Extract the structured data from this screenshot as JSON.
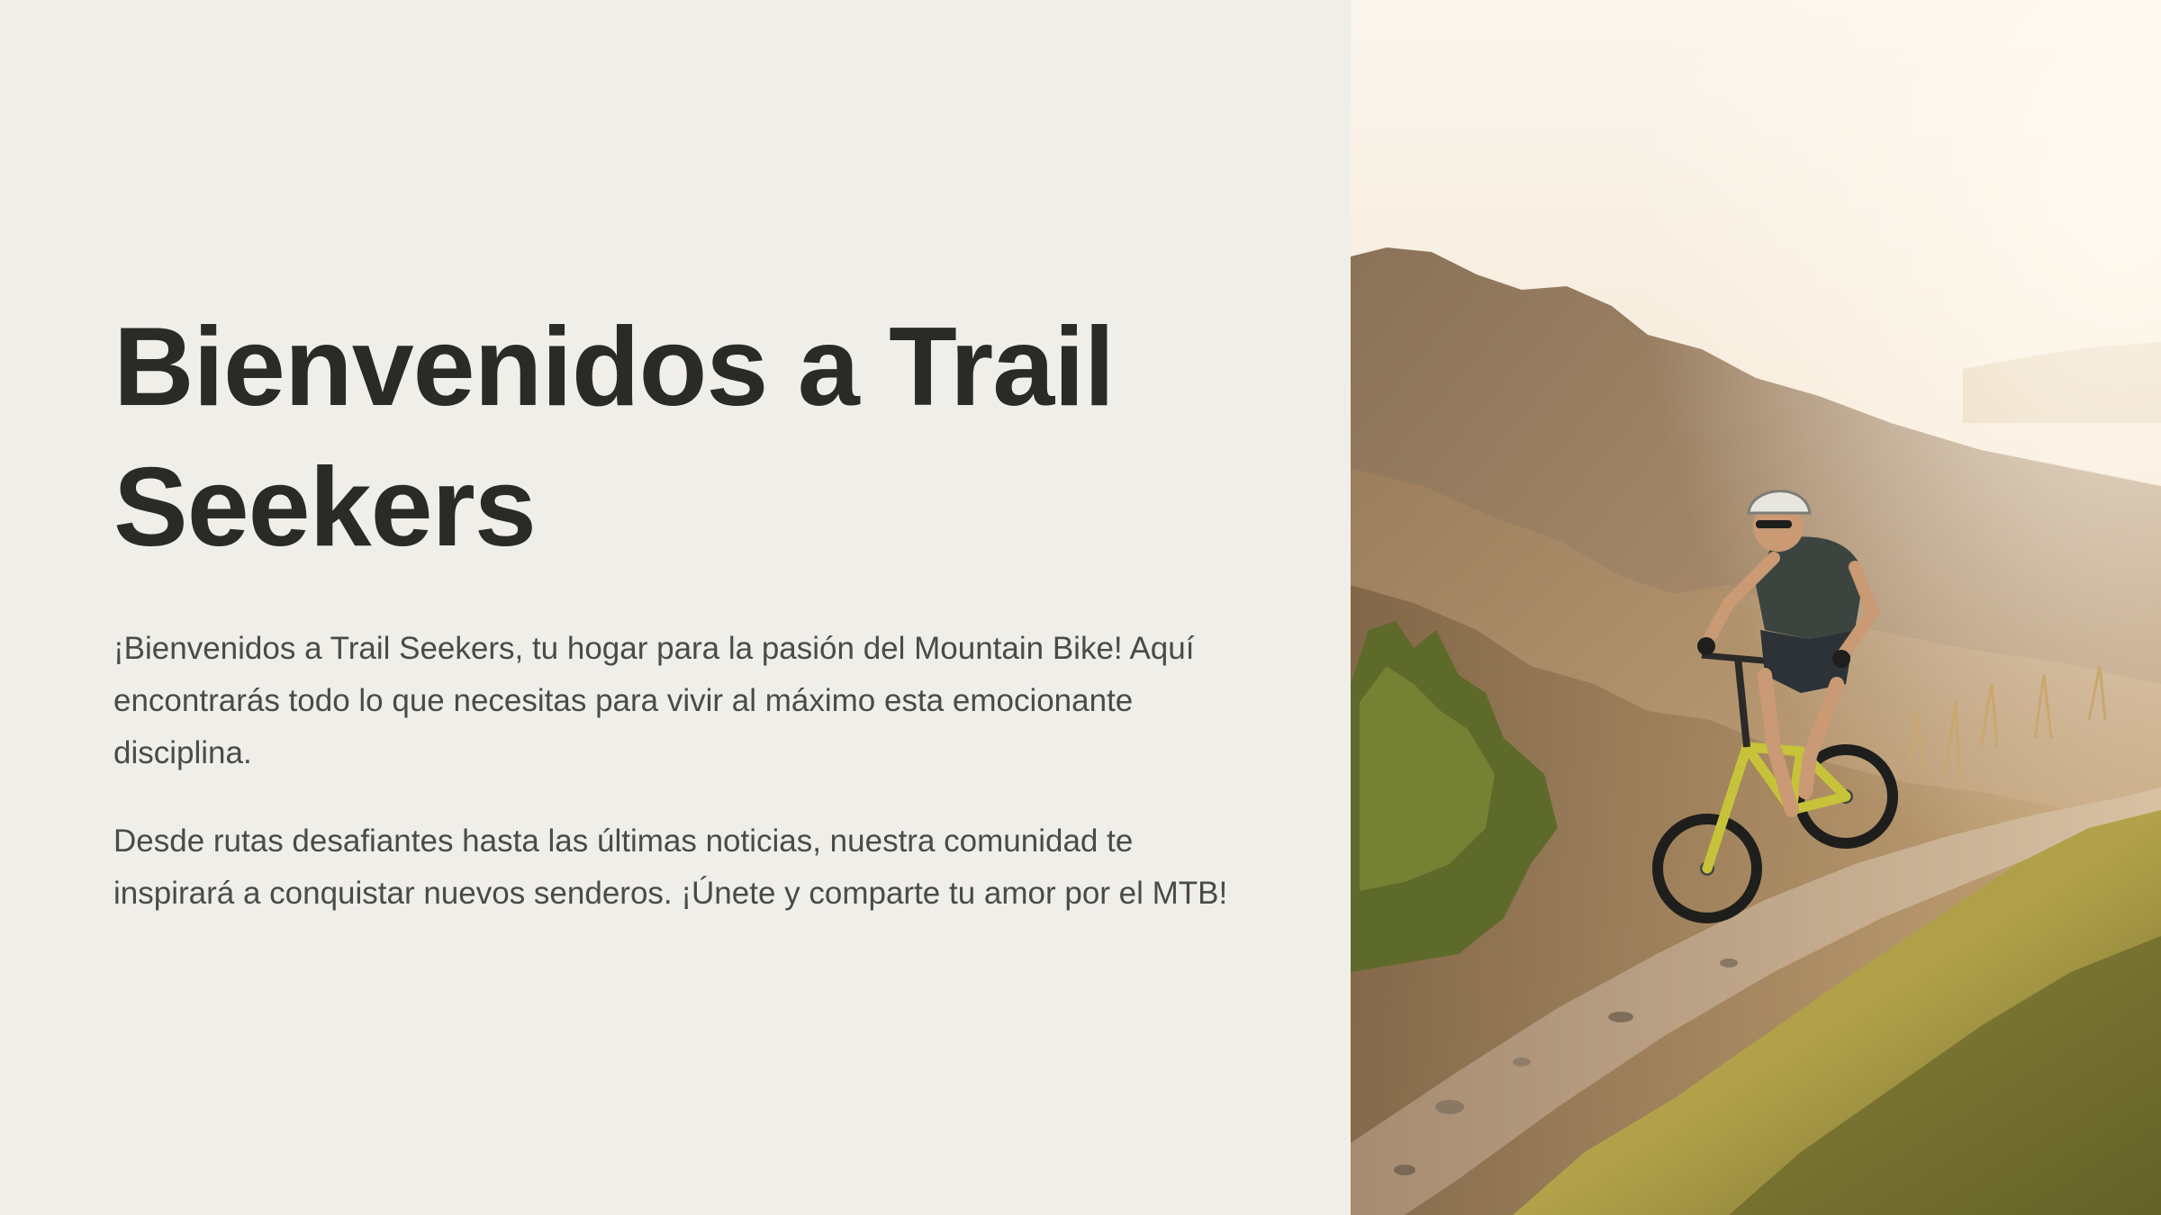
{
  "slide": {
    "title": "Bienvenidos a Trail Seekers",
    "paragraph_1": "¡Bienvenidos a Trail Seekers, tu hogar para la pasión del Mountain Bike! Aquí encontrarás todo lo que necesitas para vivir al máximo esta emocionante disciplina.",
    "paragraph_2": "Desde rutas desafiantes hasta las últimas noticias, nuestra comunidad te inspirará a conquistar nuevos senderos. ¡Únete y comparte tu amor por el MTB!"
  },
  "image": {
    "subject": "mountain-biker-on-trail-photo"
  },
  "colors": {
    "background": "#f0eee9",
    "title": "#2a2a27",
    "body": "#4a4a46"
  }
}
